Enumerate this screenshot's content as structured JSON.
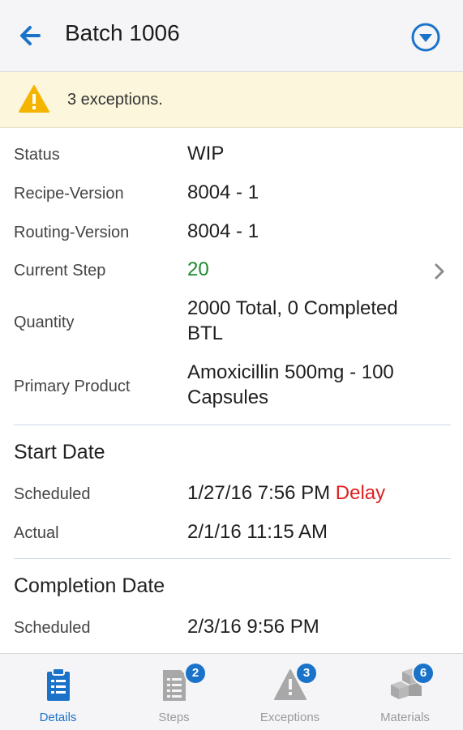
{
  "header": {
    "title": "Batch 1006"
  },
  "banner": {
    "text": "3 exceptions."
  },
  "details": {
    "status_label": "Status",
    "status_value": "WIP",
    "recipe_label": "Recipe-Version",
    "recipe_value": "8004 - 1",
    "routing_label": "Routing-Version",
    "routing_value": "8004 - 1",
    "step_label": "Current Step",
    "step_value": "20",
    "quantity_label": "Quantity",
    "quantity_line1": "2000 Total, 0 Completed",
    "quantity_line2": "BTL",
    "product_label": "Primary Product",
    "product_line1": "Amoxicillin 500mg - 100",
    "product_line2": "Capsules"
  },
  "start_date": {
    "title": "Start Date",
    "scheduled_label": "Scheduled",
    "scheduled_value": "1/27/16 7:56 PM",
    "delay": "Delay",
    "actual_label": "Actual",
    "actual_value": "2/1/16 11:15 AM"
  },
  "completion_date": {
    "title": "Completion Date",
    "scheduled_label": "Scheduled",
    "scheduled_value": "2/3/16 9:56 PM"
  },
  "tabs": [
    {
      "label": "Details",
      "icon": "clipboard-icon",
      "active": true
    },
    {
      "label": "Steps",
      "icon": "document-list-icon",
      "badge": "2"
    },
    {
      "label": "Exceptions",
      "icon": "warning-icon",
      "badge": "3"
    },
    {
      "label": "Materials",
      "icon": "boxes-icon",
      "badge": "6"
    }
  ],
  "colors": {
    "accent": "#1a73c9",
    "warning": "#f5b400",
    "green": "#1c8a2e",
    "delay": "#e02020",
    "banner_bg": "#fbf6dc"
  }
}
